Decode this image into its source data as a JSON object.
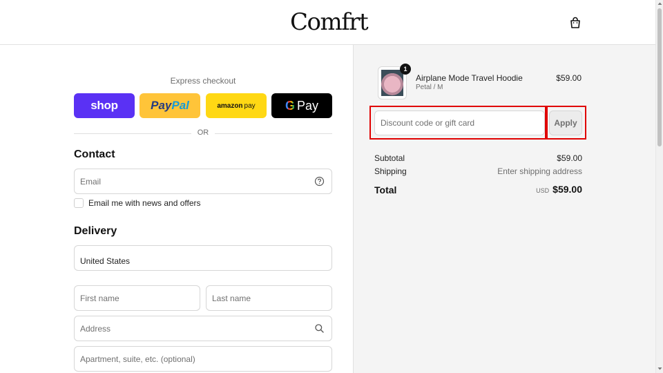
{
  "header": {
    "logo": "Comfrt",
    "cart_icon": "shopping-bag-icon"
  },
  "express": {
    "label": "Express checkout",
    "buttons": {
      "shop": "shop",
      "paypal_a": "Pay",
      "paypal_b": "Pal",
      "amazon_a": "amazon",
      "amazon_b": "pay",
      "gpay_g": "G",
      "gpay_text": "Pay"
    },
    "or": "OR"
  },
  "contact": {
    "title": "Contact",
    "email_placeholder": "Email",
    "email_help_icon": "question-circle-icon",
    "newsletter_label": "Email me with news and offers"
  },
  "delivery": {
    "title": "Delivery",
    "country_value": "United States",
    "first_name_placeholder": "First name",
    "last_name_placeholder": "Last name",
    "address_placeholder": "Address",
    "address_search_icon": "search-icon",
    "apartment_placeholder": "Apartment, suite, etc. (optional)"
  },
  "summary": {
    "product": {
      "name": "Airplane Mode Travel Hoodie",
      "variant": "Petal / M",
      "price": "$59.00",
      "quantity": "1"
    },
    "discount_placeholder": "Discount code or gift card",
    "apply_label": "Apply",
    "subtotal_label": "Subtotal",
    "subtotal_value": "$59.00",
    "shipping_label": "Shipping",
    "shipping_value": "Enter shipping address",
    "total_label": "Total",
    "total_currency": "USD",
    "total_value": "$59.00"
  },
  "colors": {
    "shop_purple": "#5a31f4",
    "paypal_yellow": "#ffc439",
    "amazon_yellow": "#ffd814",
    "gpay_black": "#000000",
    "highlight_red": "#e00000",
    "summary_bg": "#f4f4f4"
  }
}
